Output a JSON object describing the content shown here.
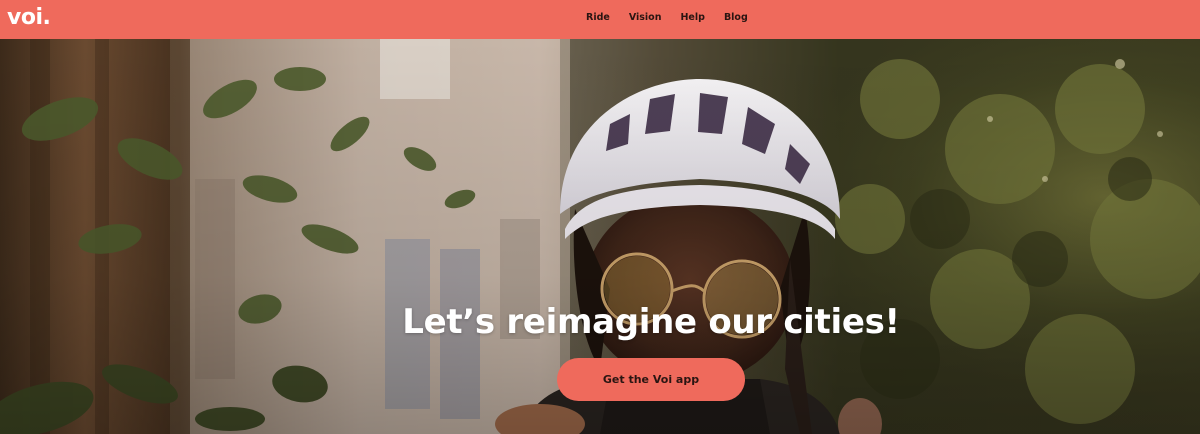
{
  "brand": {
    "logo_text": "voi.",
    "color_primary": "#ef6a5c"
  },
  "nav": {
    "items": [
      {
        "label": "Ride"
      },
      {
        "label": "Vision"
      },
      {
        "label": "Help"
      },
      {
        "label": "Blog"
      }
    ]
  },
  "hero": {
    "headline": "Let’s reimagine our cities!",
    "cta_label": "Get the Voi app",
    "image_description_icon": "hero-photo"
  }
}
